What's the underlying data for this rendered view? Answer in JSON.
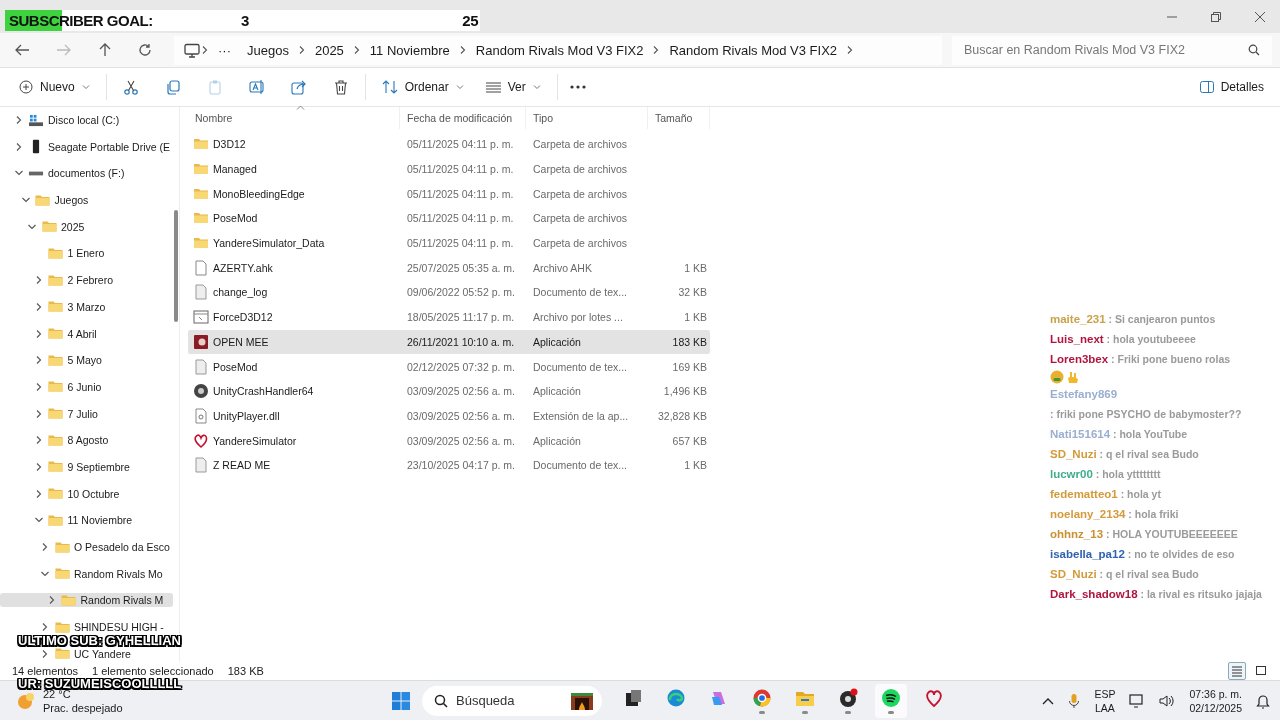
{
  "overlay": {
    "goal_label": "SUBSCRIBER GOAL:",
    "current": "3",
    "target": "25",
    "level": 0.12,
    "last_sub": "ULTIMO SUB: GYHELLIAN",
    "second_line": "UR: SUZUMEISCOOLLLLL"
  },
  "address_bar": {
    "more": "···",
    "crumbs": [
      "Juegos",
      "2025",
      "11 Noviembre",
      "Random Rivals Mod V3 FIX2",
      "Random Rivals Mod V3 FIX2"
    ],
    "search_placeholder": "Buscar en Random Rivals Mod V3 FIX2"
  },
  "command_bar": {
    "new_label": "Nuevo",
    "actions": [
      {
        "kind": "cut",
        "disabled": false
      },
      {
        "kind": "copy",
        "disabled": false
      },
      {
        "kind": "paste",
        "disabled": true
      },
      {
        "kind": "rename",
        "disabled": false
      },
      {
        "kind": "share",
        "disabled": false
      },
      {
        "kind": "delete",
        "disabled": false
      }
    ],
    "sort_label": "Ordenar",
    "view_label": "Ver",
    "details_label": "Detalles"
  },
  "nav_tree": [
    {
      "label": "Disco local (C:)",
      "kind": "system",
      "expandable": true,
      "expanded": false,
      "selected": false
    },
    {
      "label": "Seagate Portable Drive (E",
      "kind": "portable",
      "expandable": true,
      "expanded": false,
      "selected": false
    },
    {
      "label": "documentos (F:)",
      "kind": "drive",
      "expandable": true,
      "expanded": true,
      "selected": false,
      "children": [
        {
          "label": "Juegos",
          "kind": "folder",
          "expandable": true,
          "expanded": true,
          "selected": false,
          "children": [
            {
              "label": "2025",
              "kind": "folder",
              "expandable": true,
              "expanded": true,
              "selected": false,
              "children": [
                {
                  "label": "1 Enero",
                  "kind": "folder",
                  "expandable": false,
                  "selected": false
                },
                {
                  "label": "2 Febrero",
                  "kind": "folder",
                  "expandable": true,
                  "expanded": false,
                  "selected": false
                },
                {
                  "label": "3 Marzo",
                  "kind": "folder",
                  "expandable": true,
                  "expanded": false,
                  "selected": false
                },
                {
                  "label": "4 Abril",
                  "kind": "folder",
                  "expandable": true,
                  "expanded": false,
                  "selected": false
                },
                {
                  "label": "5 Mayo",
                  "kind": "folder",
                  "expandable": true,
                  "expanded": false,
                  "selected": false
                },
                {
                  "label": "6 Junio",
                  "kind": "folder",
                  "expandable": true,
                  "expanded": false,
                  "selected": false
                },
                {
                  "label": "7 Julio",
                  "kind": "folder",
                  "expandable": true,
                  "expanded": false,
                  "selected": false
                },
                {
                  "label": "8 Agosto",
                  "kind": "folder",
                  "expandable": true,
                  "expanded": false,
                  "selected": false
                },
                {
                  "label": "9 Septiembre",
                  "kind": "folder",
                  "expandable": true,
                  "expanded": false,
                  "selected": false
                },
                {
                  "label": "10 Octubre",
                  "kind": "folder",
                  "expandable": true,
                  "expanded": false,
                  "selected": false
                },
                {
                  "label": "11 Noviembre",
                  "kind": "folder",
                  "expandable": true,
                  "expanded": true,
                  "selected": false,
                  "children": [
                    {
                      "label": "O Pesadelo da Esco",
                      "kind": "folder",
                      "expandable": true,
                      "expanded": false,
                      "selected": false
                    },
                    {
                      "label": "Random Rivals Mo",
                      "kind": "folder",
                      "expandable": true,
                      "expanded": true,
                      "selected": false,
                      "children": [
                        {
                          "label": "Random Rivals M",
                          "kind": "folder",
                          "expandable": true,
                          "expanded": false,
                          "selected": true
                        }
                      ]
                    },
                    {
                      "label": "SHINDESU HIGH -",
                      "kind": "folder",
                      "expandable": true,
                      "expanded": false,
                      "selected": false
                    },
                    {
                      "label": "UC Yandere",
                      "kind": "folder",
                      "expandable": true,
                      "expanded": false,
                      "selected": false
                    }
                  ]
                }
              ]
            }
          ]
        }
      ]
    }
  ],
  "file_list": {
    "columns": [
      "Nombre",
      "Fecha de modificación",
      "Tipo",
      "Tamaño"
    ],
    "rows": [
      {
        "name": "D3D12",
        "date": "05/11/2025 04:11 p. m.",
        "type": "Carpeta de archivos",
        "kind": "folder",
        "selected": false
      },
      {
        "name": "Managed",
        "date": "05/11/2025 04:11 p. m.",
        "type": "Carpeta de archivos",
        "kind": "folder",
        "selected": false
      },
      {
        "name": "MonoBleedingEdge",
        "date": "05/11/2025 04:11 p. m.",
        "type": "Carpeta de archivos",
        "kind": "folder",
        "selected": false
      },
      {
        "name": "PoseMod",
        "date": "05/11/2025 04:11 p. m.",
        "type": "Carpeta de archivos",
        "kind": "folder",
        "selected": false
      },
      {
        "name": "YandereSimulator_Data",
        "date": "05/11/2025 04:11 p. m.",
        "type": "Carpeta de archivos",
        "kind": "folder",
        "selected": false
      },
      {
        "name": "AZERTY.ahk",
        "date": "25/07/2025 05:35 a. m.",
        "type": "Archivo AHK",
        "size": "1 KB",
        "kind": "blank",
        "selected": false
      },
      {
        "name": "change_log",
        "date": "09/06/2022 05:52 p. m.",
        "type": "Documento de tex...",
        "size": "32 KB",
        "kind": "text",
        "selected": false
      },
      {
        "name": "ForceD3D12",
        "date": "18/05/2025 11:17 p. m.",
        "type": "Archivo por lotes ...",
        "size": "1 KB",
        "kind": "batch",
        "selected": false
      },
      {
        "name": "OPEN MEE",
        "date": "26/11/2021 10:10 a. m.",
        "type": "Aplicación",
        "size": "183 KB",
        "kind": "launcher",
        "selected": true
      },
      {
        "name": "PoseMod",
        "date": "02/12/2025 07:32 p. m.",
        "type": "Documento de tex...",
        "size": "169 KB",
        "kind": "text",
        "selected": false
      },
      {
        "name": "UnityCrashHandler64",
        "date": "03/09/2025 02:56 a. m.",
        "type": "Aplicación",
        "size": "1,496 KB",
        "kind": "unity",
        "selected": false
      },
      {
        "name": "UnityPlayer.dll",
        "date": "03/09/2025 02:56 a. m.",
        "type": "Extensión de la ap...",
        "size": "32,828 KB",
        "kind": "library",
        "selected": false
      },
      {
        "name": "YandereSimulator",
        "date": "03/09/2025 02:56 a. m.",
        "type": "Aplicación",
        "size": "657 KB",
        "kind": "heart",
        "selected": false
      },
      {
        "name": "Z READ ME",
        "date": "23/10/2025 04:17 p. m.",
        "type": "Documento de tex...",
        "size": "1 KB",
        "kind": "text",
        "selected": false
      }
    ]
  },
  "status_bar": {
    "count": "14 elementos",
    "selection": "1 elemento seleccionado",
    "size": "183 KB",
    "views": [
      {
        "kind": "details",
        "selected": true
      },
      {
        "kind": "tiles",
        "selected": false
      }
    ]
  },
  "chat": [
    {
      "user": "maite_231",
      "color": "#c9a24a",
      "text": ": Si canjearon puntos",
      "kind": "plain"
    },
    {
      "user": "Luis_next",
      "color": "#b0153f",
      "text": ": hola youtubeeee",
      "kind": "plain"
    },
    {
      "user": "Loren3bex",
      "color": "#b0153f",
      "text": ": Friki pone bueno rolas",
      "kind": "emoji"
    },
    {
      "user": "Estefany869",
      "color": "#9aaed0",
      "text": ": friki pone PSYCHO de babymoster??",
      "kind": "plain"
    },
    {
      "user": "Nati151614",
      "color": "#9aaed0",
      "text": ": hola YouTube",
      "kind": "plain"
    },
    {
      "user": "SD_Nuzi",
      "color": "#d39a3a",
      "text": ": q el rival sea Budo",
      "kind": "plain"
    },
    {
      "user": "lucwr00",
      "color": "#3fae8c",
      "text": ": hola ytttttttt",
      "kind": "plain"
    },
    {
      "user": "fedematteo1",
      "color": "#d39a3a",
      "text": ": hola yt",
      "kind": "plain"
    },
    {
      "user": "noelany_2134",
      "color": "#d39a3a",
      "text": ": hola friki",
      "kind": "plain"
    },
    {
      "user": "ohhnz_13",
      "color": "#c8902e",
      "text": ": HOLA YOUTUBEEEEEEE",
      "kind": "plain"
    },
    {
      "user": "isabella_pa12",
      "color": "#2f62b0",
      "text": ": no te olvides de eso",
      "kind": "plain"
    },
    {
      "user": "SD_Nuzi",
      "color": "#d39a3a",
      "text": ": q el rival sea Budo",
      "kind": "plain"
    },
    {
      "user": "Dark_shadow18",
      "color": "#b0153f",
      "text": ": la rival es ritsuko jajaja",
      "kind": "plain"
    }
  ],
  "taskbar": {
    "temperature": "22 °C",
    "weather": "Prac. despejado",
    "search_placeholder": "Búsqueda",
    "apps": [
      {
        "kind": "taskview",
        "running": false,
        "active": false
      },
      {
        "kind": "edge",
        "running": false,
        "active": false
      },
      {
        "kind": "copilot",
        "running": false,
        "active": false
      },
      {
        "kind": "chrome",
        "running": true,
        "active": false
      },
      {
        "kind": "explorer",
        "running": true,
        "active": false
      },
      {
        "kind": "obs",
        "running": true,
        "active": false
      },
      {
        "kind": "spotify",
        "running": true,
        "active": true
      },
      {
        "kind": "heart",
        "running": false,
        "active": false
      }
    ],
    "language": "ESP",
    "layout": "LAA",
    "time": "07:36 p. m.",
    "date": "02/12/2025"
  }
}
